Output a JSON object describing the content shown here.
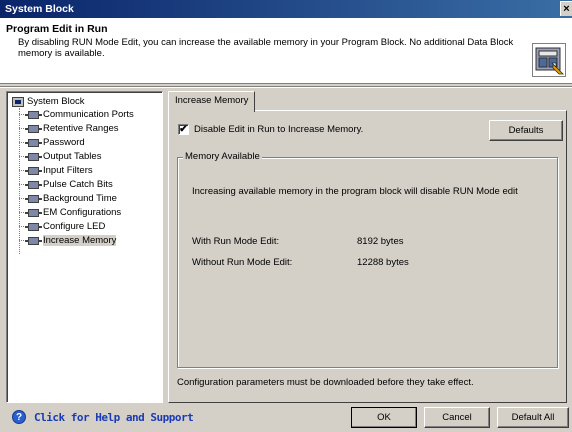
{
  "window": {
    "title": "System Block",
    "close_glyph": "×"
  },
  "header": {
    "title": "Program Edit in Run",
    "description": "By disabling RUN Mode Edit, you can increase the available memory in your Program Block.  No additional Data Block memory is available.",
    "icon": "plc-memory-icon"
  },
  "tree": {
    "root": "System Block",
    "items": [
      "Communication Ports",
      "Retentive Ranges",
      "Password",
      "Output Tables",
      "Input Filters",
      "Pulse Catch Bits",
      "Background Time",
      "EM Configurations",
      "Configure LED",
      "Increase Memory"
    ],
    "selected": "Increase Memory"
  },
  "tab": {
    "label": "Increase Memory"
  },
  "panel": {
    "checkbox_label": "Disable Edit in Run to Increase Memory.",
    "checkbox_checked": true,
    "check_glyph": "✔",
    "defaults_label": "Defaults",
    "group_label": "Memory Available",
    "info": "Increasing available memory in the program block will disable RUN Mode edit",
    "with_label": "With Run Mode Edit:",
    "with_value": "8192 bytes",
    "without_label": "Without Run Mode Edit:",
    "without_value": "12288 bytes",
    "config_note": "Configuration parameters must be downloaded before they take effect."
  },
  "footer": {
    "help_glyph": "?",
    "help_text": "Click for Help and Support",
    "ok_label": "OK",
    "cancel_label": "Cancel",
    "default_all_label": "Default All"
  }
}
